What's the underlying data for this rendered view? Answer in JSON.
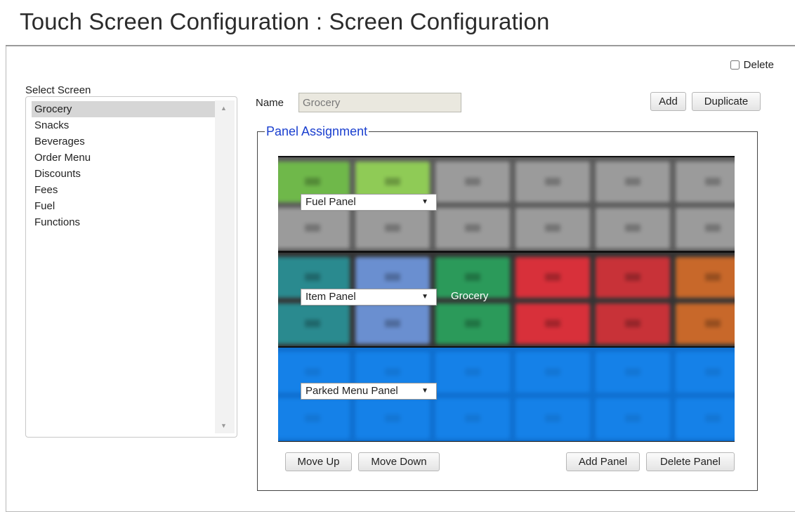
{
  "page": {
    "title": "Touch Screen Configuration : Screen Configuration"
  },
  "delete_label": "Delete",
  "select_screen": {
    "label": "Select Screen",
    "items": [
      "Grocery",
      "Snacks",
      "Beverages",
      "Order Menu",
      "Discounts",
      "Fees",
      "Fuel",
      "Functions"
    ],
    "selected": "Grocery"
  },
  "name_field": {
    "label": "Name",
    "value": "Grocery"
  },
  "buttons": {
    "add": "Add",
    "duplicate": "Duplicate",
    "move_up": "Move Up",
    "move_down": "Move Down",
    "add_panel": "Add Panel",
    "delete_panel": "Delete Panel"
  },
  "panel_assignment": {
    "legend": "Panel Assignment",
    "panels": [
      {
        "selected": "Fuel Panel",
        "caption": ""
      },
      {
        "selected": "Item Panel",
        "caption": "Grocery"
      },
      {
        "selected": "Parked Menu Panel",
        "caption": ""
      }
    ]
  },
  "colors": {
    "legend": "#1a3fcf",
    "list_selected": "#d6d6d6",
    "name_input_bg": "#eae8df",
    "fuel_panel_bg": "#5b5b5b",
    "item_panel_bg": "#353535",
    "parked_panel_bg": "#0f6fcf",
    "item_tile_colors": [
      "#2a8a8f",
      "#6a8fd0",
      "#2b9a5a",
      "#d8303a",
      "#c83238",
      "#c8682a"
    ]
  },
  "icons": {
    "dropdown": "triangle-down-icon",
    "scroll_up": "triangle-up-icon",
    "scroll_down": "triangle-down-icon"
  }
}
